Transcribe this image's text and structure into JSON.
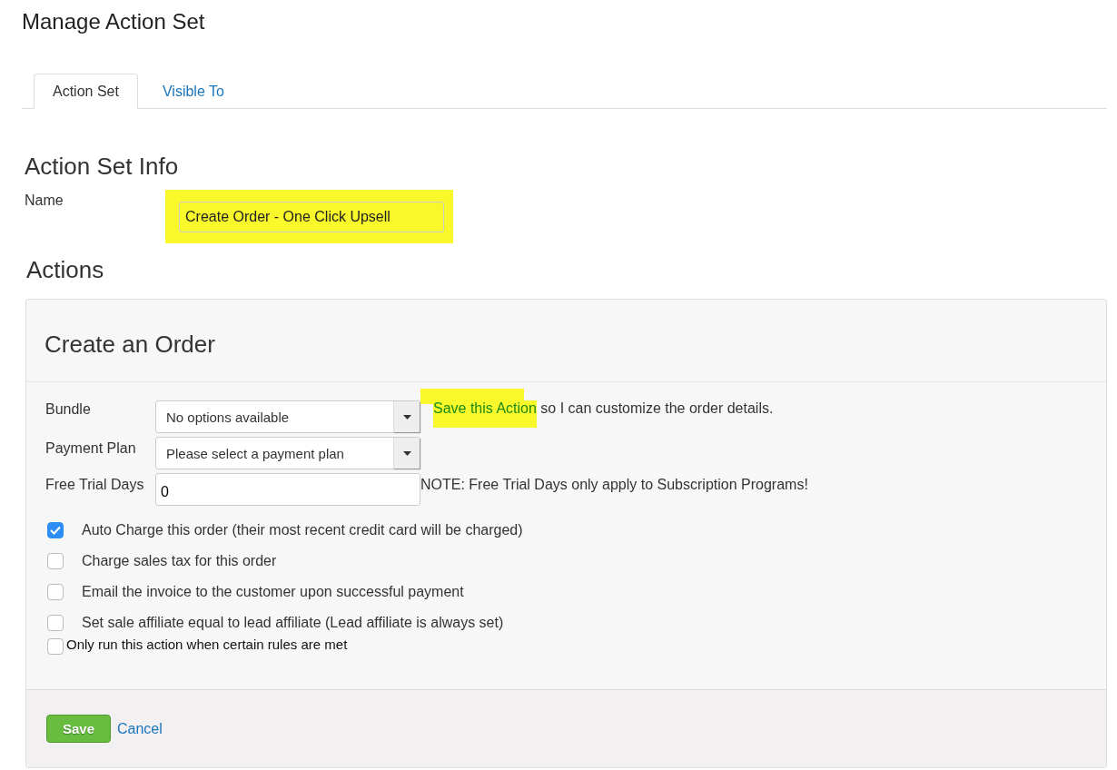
{
  "page": {
    "title": "Manage Action Set"
  },
  "tabs": [
    {
      "label": "Action Set",
      "selected": true
    },
    {
      "label": "Visible To",
      "selected": false
    }
  ],
  "info": {
    "heading": "Action Set Info",
    "name_label": "Name",
    "name_value": "Create Order - One Click Upsell",
    "highlighted": true
  },
  "actions": {
    "heading": "Actions",
    "panel": {
      "title": "Create an Order",
      "fields": [
        {
          "kind": "select",
          "label": "Bundle",
          "value": "No options available",
          "note_link": "Save this Action",
          "note_link_highlighted": true,
          "note": " so I can customize the order details."
        },
        {
          "kind": "select",
          "label": "Payment Plan",
          "value": "Please select a payment plan"
        },
        {
          "kind": "input",
          "label": "Free Trial Days",
          "value": "0",
          "note": "NOTE: Free Trial Days only apply to Subscription Programs!"
        }
      ],
      "checkboxes": [
        {
          "label": "Auto Charge this order (their most recent credit card will be charged)",
          "checked": true
        },
        {
          "label": "Charge sales tax for this order",
          "checked": false
        },
        {
          "label": "Email the invoice to the customer upon successful payment",
          "checked": false
        },
        {
          "label": "Set sale affiliate equal to lead affiliate (Lead affiliate is always set)",
          "checked": false
        }
      ],
      "rules_checkbox": {
        "label": "Only run this action when certain rules are met",
        "checked": false
      },
      "buttons": {
        "save": "Save",
        "cancel": "Cancel"
      }
    }
  }
}
